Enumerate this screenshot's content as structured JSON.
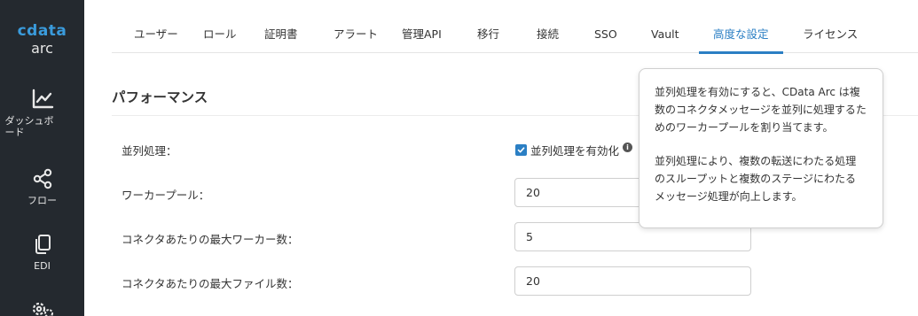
{
  "brand": {
    "logo_text": "cdata",
    "product": "arc",
    "accent": "#2b7fc4",
    "logo_color": "#3a9bdc",
    "sidebar_bg": "#24292f"
  },
  "sidebar": {
    "items": [
      {
        "label": "ダッシュボード",
        "icon": "chart-line-icon"
      },
      {
        "label": "フロー",
        "icon": "share-nodes-icon"
      },
      {
        "label": "EDI",
        "icon": "documents-icon"
      },
      {
        "label": "",
        "icon": "gears-icon"
      }
    ]
  },
  "tabs": [
    {
      "label": "ユーザー"
    },
    {
      "label": "ロール"
    },
    {
      "label": "証明書"
    },
    {
      "label": "アラート"
    },
    {
      "label": "管理API"
    },
    {
      "label": "移行"
    },
    {
      "label": "接続"
    },
    {
      "label": "SSO"
    },
    {
      "label": "Vault"
    },
    {
      "label": "高度な設定",
      "active": true
    },
    {
      "label": "ライセンス"
    }
  ],
  "section": {
    "title": "パフォーマンス",
    "parallel_label": "並列処理：",
    "parallel_checkbox_label": "並列処理を有効化",
    "parallel_checked": true,
    "worker_pool_label": "ワーカープール：",
    "worker_pool_value": "20",
    "max_workers_label": "コネクタあたりの最大ワーカー数：",
    "max_workers_value": "5",
    "max_files_label": "コネクタあたりの最大ファイル数：",
    "max_files_value": "20"
  },
  "tooltip": {
    "paragraph1": "並列処理を有効にすると、CData Arc は複数のコネクタメッセージを並列に処理するためのワーカープールを割り当てます。",
    "paragraph2": "並列処理により、複数の転送にわたる処理のスループットと複数のステージにわたるメッセージ処理が向上します。"
  }
}
